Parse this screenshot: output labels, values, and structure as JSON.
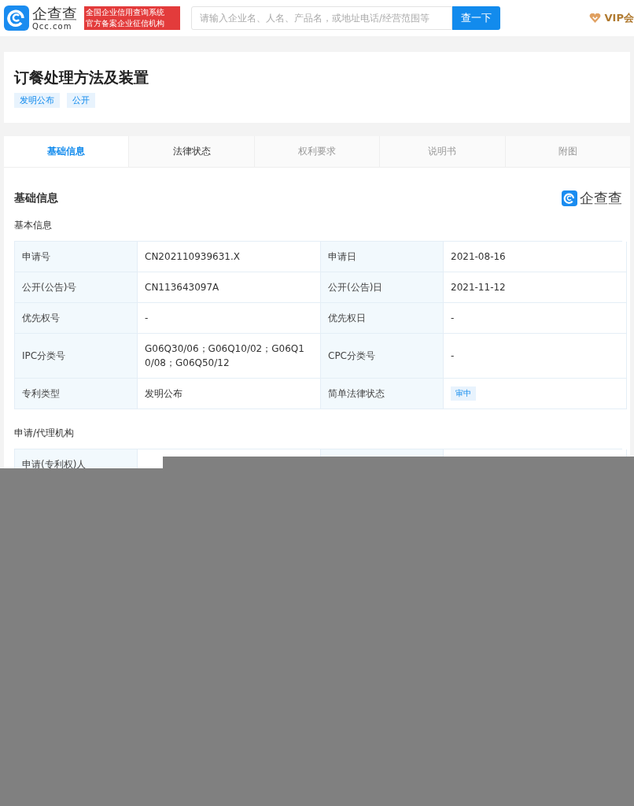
{
  "header": {
    "logo_text": "企查查",
    "logo_domain": "Qcc.com",
    "badge_lines": [
      "全国企业信用查询系统",
      "官方备案企业征信机构"
    ],
    "search": {
      "placeholder": "请输入企业名、人名、产品名，或地址电话/经营范围等"
    },
    "search_button": "查一下",
    "vip": "VIP会"
  },
  "patent": {
    "title": "订餐处理方法及装置",
    "tags": [
      "发明公布",
      "公开"
    ]
  },
  "tabs": [
    {
      "label": "基础信息",
      "selected": true,
      "disabled": false
    },
    {
      "label": "法律状态",
      "selected": false,
      "disabled": false
    },
    {
      "label": "权利要求",
      "selected": false,
      "disabled": true
    },
    {
      "label": "说明书",
      "selected": false,
      "disabled": true
    },
    {
      "label": "附图",
      "selected": false,
      "disabled": true
    }
  ],
  "section": {
    "title": "基础信息",
    "watermark_text": "企查查",
    "subtitle": "基本信息"
  },
  "basic_table": [
    {
      "label1": "申请号",
      "value1": "CN202110939631.X",
      "label2": "申请日",
      "value2": "2021-08-16"
    },
    {
      "label1": "公开(公告)号",
      "value1": "CN113643097A",
      "label2": "公开(公告)日",
      "value2": "2021-11-12"
    },
    {
      "label1": "优先权号",
      "value1": "-",
      "label2": "优先权日",
      "value2": "-"
    },
    {
      "label1": "IPC分类号",
      "value1": "G06Q30/06；G06Q10/02；G06Q10/08；G06Q50/12",
      "label2": "CPC分类号",
      "value2": "-"
    },
    {
      "label1": "专利类型",
      "value1": "发明公布",
      "label2": "简单法律状态",
      "value2": "审中",
      "kind": "tag"
    }
  ],
  "agency": {
    "subtitle": "申请/代理机构",
    "first_row_label": "申请(专利权)人"
  },
  "redaction": {
    "covered": true
  }
}
